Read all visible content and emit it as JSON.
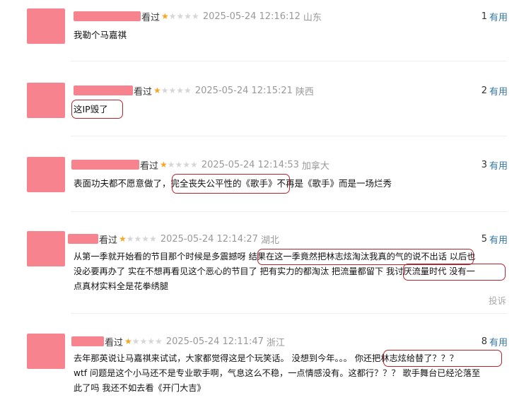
{
  "comments": [
    {
      "seen": "看过",
      "stars": 1,
      "time": "2025-05-24 12:16:12",
      "loc": "山东",
      "count": "1",
      "useful": "有用",
      "lines": [
        "我勒个马嘉祺"
      ]
    },
    {
      "seen": "看过",
      "stars": 1,
      "time": "2025-05-24 12:15:21",
      "loc": "陕西",
      "count": "2",
      "useful": "有用",
      "lines": [
        "这IP毁了"
      ]
    },
    {
      "seen": "看过",
      "stars": 1,
      "time": "2025-05-24 12:14:53",
      "loc": "加拿大",
      "count": "3",
      "useful": "有用",
      "lines": [
        "表面功夫都不愿意做了，完全丧失公平性的《歌手》不再是《歌手》而是一场烂秀"
      ]
    },
    {
      "seen": "看过",
      "stars": 1,
      "time": "2025-05-24 12:14:27",
      "loc": "湖北",
      "count": "5",
      "useful": "有用",
      "lines": [
        "从第一季就开始看的节目那个时候是多震撼呀 结果在这一季竟然把林志炫淘汰我真的气的说不出话 以后也",
        "没必要再办了 实在不想再看见这个恶心的节目了 把有实力的都淘汰 把流量都留下 我讨厌流量时代 没有一",
        "点真材实料全是花拳绣腿"
      ],
      "report": "投诉"
    },
    {
      "seen": "看过",
      "stars": 1,
      "time": "2025-05-24 12:11:47",
      "loc": "浙江",
      "count": "8",
      "useful": "有用",
      "lines": [
        "去年那英说让马嘉祺来试试，大家都觉得这是个玩笑话。 没想到今年。。。 你还把林志炫给替了？？？",
        "wtf 问题是这个小马还不是专业歌手啊，气息这么不稳，一点情感没有。这都行？？？  歌手舞台已经沦落至",
        "此了吗 我还不如去看《开门大吉》"
      ]
    }
  ],
  "colors": {
    "avatar": "#f7838f",
    "star_on": "#f5a623",
    "star_off": "#d6d6d6",
    "link": "#3377aa",
    "highlight": "#b3262b"
  }
}
